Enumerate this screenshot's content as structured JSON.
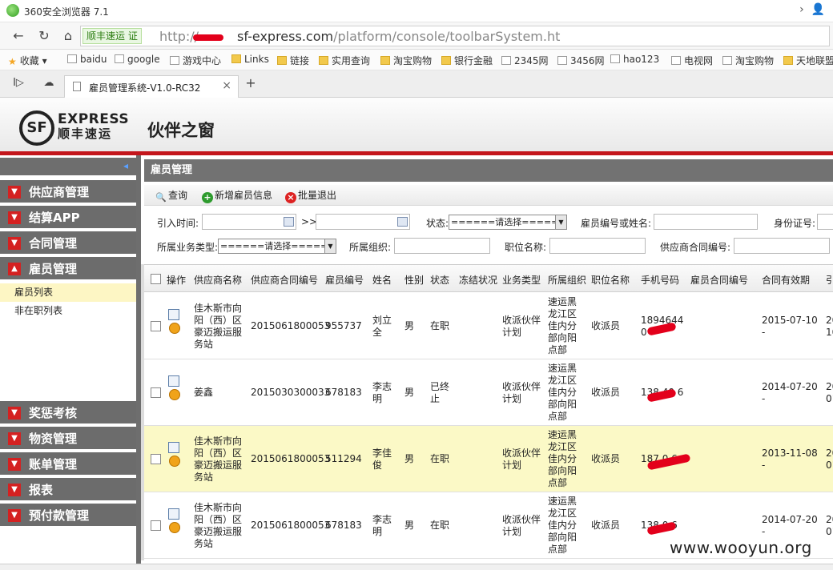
{
  "browser": {
    "title": "360安全浏览器 7.1",
    "security_badge": "顺丰速运 证",
    "url_prefix": "http://",
    "url_domain": "sf-express.com",
    "url_path": "/platform/console/toolbarSystem.ht",
    "tab_label": "雇员管理系统-V1.0-RC32",
    "bookmarks": [
      "收藏",
      "baidu",
      "google",
      "游戏中心",
      "Links",
      "链接",
      "实用查询",
      "淘宝购物",
      "银行金融",
      "2345网",
      "3456网",
      "hao123",
      "电视网",
      "淘宝购物",
      "天地联盟"
    ]
  },
  "app": {
    "logo_text": "SF",
    "brand_en": "EXPRESS",
    "brand_cn": "顺丰速运",
    "title": "伙伴之窗"
  },
  "sidebar": {
    "menus_top": [
      {
        "label": "供应商管理",
        "state": "collapsed"
      },
      {
        "label": "结算APP",
        "state": "collapsed"
      },
      {
        "label": "合同管理",
        "state": "collapsed"
      },
      {
        "label": "雇员管理",
        "state": "expanded"
      }
    ],
    "submenu": [
      {
        "label": "雇员列表",
        "active": true
      },
      {
        "label": "非在职列表",
        "active": false
      }
    ],
    "menus_bottom": [
      {
        "label": "奖惩考核"
      },
      {
        "label": "物资管理"
      },
      {
        "label": "账单管理"
      },
      {
        "label": "报表"
      },
      {
        "label": "预付款管理"
      }
    ]
  },
  "panel": {
    "title": "雇员管理",
    "toolbar": {
      "query": "查询",
      "add": "新增雇员信息",
      "batch_exit": "批量退出"
    }
  },
  "filters": {
    "intro_time": "引入时间:",
    "range_sep": ">>",
    "status": "状态:",
    "status_value": "======请选择======",
    "emp_no_or_name": "雇员编号或姓名:",
    "id_no": "身份证号:",
    "biz_type": "所属业务类型:",
    "biz_type_value": "======请选择======",
    "org": "所属组织:",
    "position": "职位名称:",
    "supplier_contract": "供应商合同编号:"
  },
  "table": {
    "columns": [
      "操作",
      "供应商名称",
      "供应商合同编号",
      "雇员编号",
      "姓名",
      "性别",
      "状态",
      "冻结状况",
      "业务类型",
      "所属组织",
      "职位名称",
      "手机号码",
      "雇员合同编号",
      "合同有效期",
      "引"
    ],
    "rows": [
      {
        "supplier": "佳木斯市向阳（西）区豪迈搬运服务站",
        "contract": "2015061800053",
        "emp_no": "955737",
        "name": "刘立全",
        "gender": "男",
        "status": "在职",
        "biz": "收派伙伴计划",
        "org": "速运黑龙江区佳内分部向阳点部",
        "position": "收派员",
        "phone": "1894644 0",
        "valid": "2015-07-10 -",
        "intro": "20 10",
        "highlight": false
      },
      {
        "supplier": "姜鑫",
        "contract": "2015030300033",
        "emp_no": "678183",
        "name": "李志明",
        "gender": "男",
        "status": "已终止",
        "biz": "收派伙伴计划",
        "org": "速运黑龙江区佳内分部向阳点部",
        "position": "收派员",
        "phone": "138 40 6",
        "valid": "2014-07-20 -",
        "intro": "20 01",
        "highlight": false
      },
      {
        "supplier": "佳木斯市向阳（西）区豪迈搬运服务站",
        "contract": "2015061800053",
        "emp_no": "511294",
        "name": "李佳俊",
        "gender": "男",
        "status": "在职",
        "biz": "收派伙伴计划",
        "org": "速运黑龙江区佳内分部向阳点部",
        "position": "收派员",
        "phone": "187 0 6",
        "valid": "2013-11-08 -",
        "intro": "20 01",
        "highlight": true
      },
      {
        "supplier": "佳木斯市向阳（西）区豪迈搬运服务站",
        "contract": "2015061800053",
        "emp_no": "678183",
        "name": "李志明",
        "gender": "男",
        "status": "在职",
        "biz": "收派伙伴计划",
        "org": "速运黑龙江区佳内分部向阳点部",
        "position": "收派员",
        "phone": "138 0 6",
        "valid": "2014-07-20 -",
        "intro": "20 01",
        "highlight": false
      }
    ]
  },
  "watermark": "www.wooyun.org"
}
